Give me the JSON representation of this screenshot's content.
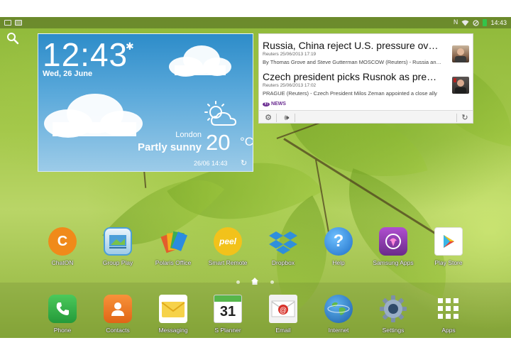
{
  "status_bar": {
    "time": "14:43",
    "left_icons": [
      "message-icon",
      "gallery-icon"
    ],
    "right_icons": [
      "nfc-icon",
      "wifi-icon",
      "mute-icon",
      "battery-icon"
    ],
    "battery_color": "#33c44a"
  },
  "weather_widget": {
    "time": "12:43",
    "date": "Wed, 26 June",
    "city": "London",
    "condition": "Partly sunny",
    "temperature": "20",
    "unit": "°C",
    "updated": "26/06 14:43"
  },
  "news_widget": {
    "items": [
      {
        "title": "Russia, China reject U.S. pressure over Snowden",
        "meta": "Reuters 25/06/2013 17:19",
        "snippet": "By Thomas Grove and Steve Gutterman MOSCOW (Reuters) - Russia and China"
      },
      {
        "title": "Czech president picks Rusnok as premier",
        "meta": "Reuters 25/06/2013 17:02",
        "snippet": "PRAGUE (Reuters) - Czech President Milos Zeman appointed a close ally"
      }
    ],
    "source_brand": "Y!",
    "source_label": "NEWS"
  },
  "apps": [
    {
      "label": "ChatON",
      "icon": "chaton-icon",
      "color": "#f08a1a"
    },
    {
      "label": "Group Play",
      "icon": "group-play-icon",
      "color": "#4b9fd8"
    },
    {
      "label": "Polaris Office",
      "icon": "polaris-office-icon",
      "color": "#e35d2c"
    },
    {
      "label": "Smart Remote",
      "icon": "smart-remote-icon",
      "color": "#f2c21b"
    },
    {
      "label": "Dropbox",
      "icon": "dropbox-icon",
      "color": "#2f8fdb"
    },
    {
      "label": "Help",
      "icon": "help-icon",
      "color": "#2d8fe0"
    },
    {
      "label": "Samsung Apps",
      "icon": "samsung-apps-icon",
      "color": "#8b3aa8"
    },
    {
      "label": "Play Store",
      "icon": "play-store-icon",
      "color": "#ffffff"
    }
  ],
  "dock": [
    {
      "label": "Phone",
      "icon": "phone-icon",
      "color": "#3bb34a"
    },
    {
      "label": "Contacts",
      "icon": "contacts-icon",
      "color": "#f07a22"
    },
    {
      "label": "Messaging",
      "icon": "messaging-icon",
      "color": "#f6d24a"
    },
    {
      "label": "S Planner",
      "icon": "calendar-icon",
      "color": "#ffffff",
      "day": "31"
    },
    {
      "label": "Email",
      "icon": "email-icon",
      "color": "#f2f2f2"
    },
    {
      "label": "Internet",
      "icon": "globe-icon",
      "color": "#2a7bc6"
    },
    {
      "label": "Settings",
      "icon": "gear-icon",
      "color": "#7d8fa8"
    },
    {
      "label": "Apps",
      "icon": "apps-grid-icon",
      "color": "#ffffff"
    }
  ],
  "pager": {
    "total_pages": 3,
    "home_page": 2
  }
}
